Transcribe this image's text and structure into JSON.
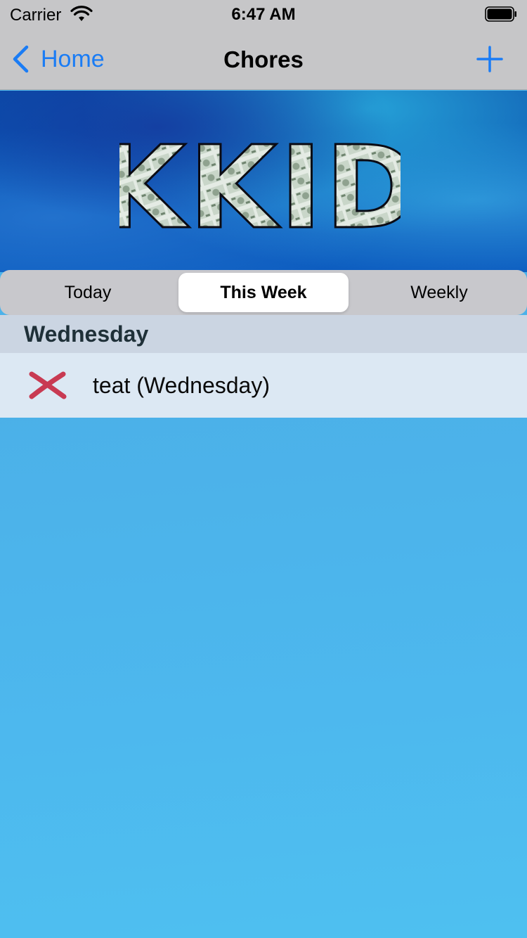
{
  "status_bar": {
    "carrier": "Carrier",
    "time": "6:47 AM"
  },
  "nav": {
    "back_label": "Home",
    "title": "Chores",
    "add_icon": "plus-icon",
    "accent_color": "#1a7cf5"
  },
  "banner": {
    "logo_text": "KKID"
  },
  "segments": [
    {
      "label": "Today",
      "selected": false
    },
    {
      "label": "This Week",
      "selected": true
    },
    {
      "label": "Weekly",
      "selected": false
    }
  ],
  "sections": [
    {
      "header": "Wednesday",
      "rows": [
        {
          "status_icon": "x-mark-icon",
          "status_color": "#c83a52",
          "label": "teat (Wednesday)"
        }
      ]
    }
  ]
}
